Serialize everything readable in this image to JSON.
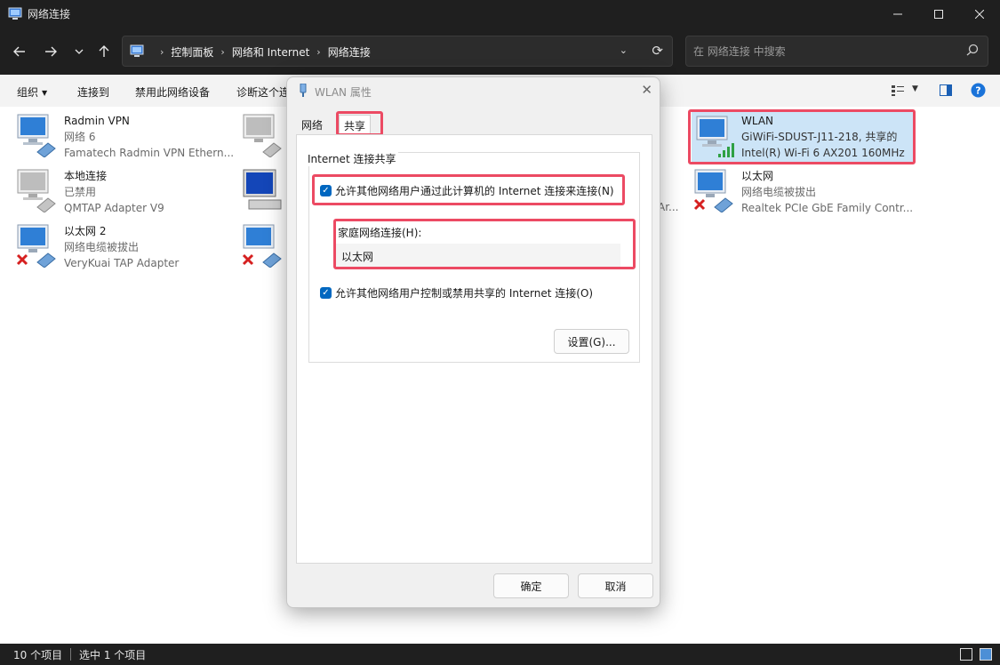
{
  "window": {
    "title": "网络连接"
  },
  "navigation": {
    "breadcrumbs": [
      "控制面板",
      "网络和 Internet",
      "网络连接"
    ],
    "search_placeholder": "在 网络连接 中搜索"
  },
  "toolbar": {
    "organize": "组织",
    "connect_to": "连接到",
    "disable_device": "禁用此网络设备",
    "diagnose": "诊断这个连"
  },
  "connections": [
    {
      "name": "Radmin VPN",
      "status": "网络 6",
      "adapter": "Famatech Radmin VPN Ethern...",
      "state": "connected"
    },
    {
      "name": "本地连接",
      "status": "已禁用",
      "adapter": "QMTAP Adapter V9",
      "state": "disabled"
    },
    {
      "name": "以太网 2",
      "status": "网络电缆被拔出",
      "adapter": "VeryKuai TAP Adapter",
      "state": "unplugged"
    },
    {
      "name": "WLAN",
      "status": "GiWiFi-SDUST-J11-218, 共享的",
      "adapter": "Intel(R) Wi-Fi 6 AX201 160MHz",
      "state": "wifi",
      "selected": true
    },
    {
      "name": "以太网",
      "status": "网络电缆被拔出",
      "adapter": "Realtek PCIe GbE Family Contr...",
      "state": "unplugged"
    }
  ],
  "hidden_fragments": {
    "adapter_partial": "Ar..."
  },
  "status_bar": {
    "item_count": "10 个项目",
    "selected_count": "选中 1 个项目"
  },
  "dialog": {
    "title": "WLAN 属性",
    "tabs": [
      "网络",
      "共享"
    ],
    "active_tab": "共享",
    "group_title": "Internet 连接共享",
    "allow_share_label": "允许其他网络用户通过此计算机的 Internet 连接来连接(N)",
    "allow_share_checked": true,
    "home_network_label": "家庭网络连接(H):",
    "home_network_value": "以太网",
    "allow_control_label": "允许其他网络用户控制或禁用共享的 Internet 连接(O)",
    "allow_control_checked": true,
    "settings_button": "设置(G)...",
    "ok_button": "确定",
    "cancel_button": "取消"
  },
  "colors": {
    "accent": "#0067c0",
    "highlight_box": "#ec4a63",
    "dark_chrome": "#1f1f1f",
    "selected_item_bg": "#cce4f7"
  }
}
